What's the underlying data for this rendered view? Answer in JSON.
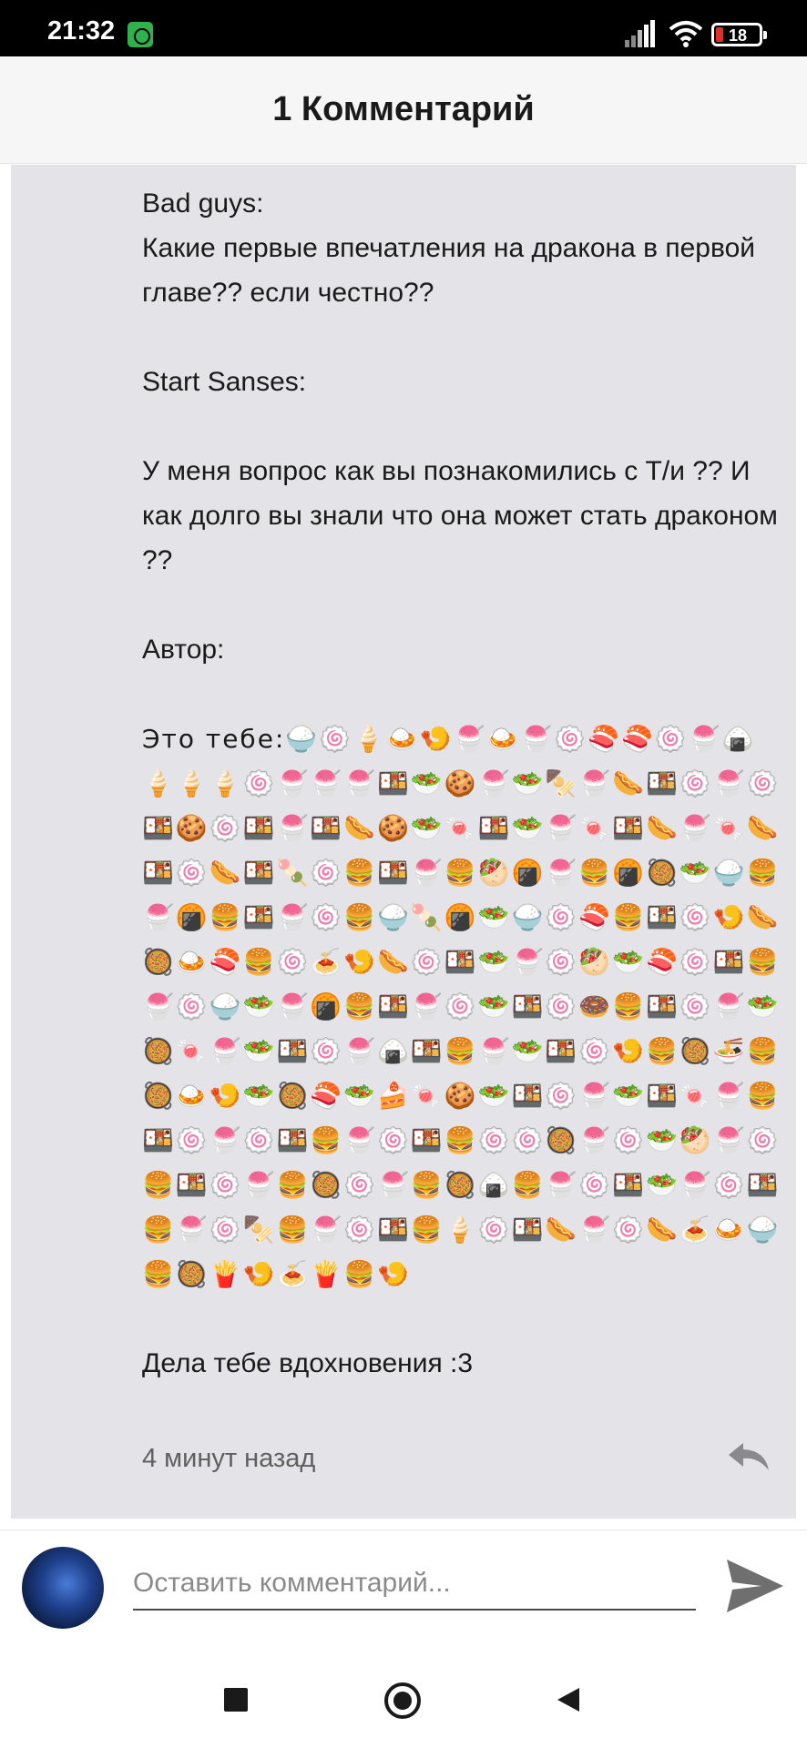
{
  "status_bar": {
    "time": "21:32",
    "battery_level": "18",
    "icons": [
      "app-notification-icon",
      "signal-icon",
      "wifi-icon",
      "battery-icon"
    ]
  },
  "header": {
    "title": "1 Комментарий"
  },
  "comment": {
    "lines": [
      "Bad guys:",
      "Какие первые впечатления на дракона в первой главе?? если честно??",
      "",
      "Start Sanses:",
      "",
      "У меня вопрос как вы познакомились с Т/и ?? И как долго вы знали что она может стать драконом ??",
      "",
      "Автор:",
      ""
    ],
    "emoji_label": "Это тебе:",
    "emoji_text": "🍚🍥🍦🍛🍤🍧🍛🍧🍥🍣🍣🍥🍧🍙🍦🍦🍦🍥🍧🍧🍧🍱🥗🍪🍧🥗🍢🍧🌭🍱🍥🍧🍥🍱🍪🍥🍱🍧🍱🌭🍪🥗🍬🍱🥗🍧🍬🍱🌭🍧🍬🌭🍱🍥🌭🍱🍡🍥🍔🍱🍧🍔🥙🍘🍧🍔🍘🥘🥗🍚🍔🍧🍘🍔🍱🍧🍥🍔🍚🍡🍘🥗🍚🍥🍣🍔🍱🍥🍤🌭🥘🍛🍣🍔🍥🍝🍤🌭🍥🍱🥗🍧🍥🥙🥗🍣🍥🍱🍔🍧🍥🍚🥗🍧🍘🍔🍱🍧🍥🥗🍱🍥🍩🍔🍱🍥🍧🥗🥘🍬🍧🥗🍱🍥🍧🍙🍱🍔🍧🥗🍱🍥🍤🍔🥘🍜🍔🥘🍛🍤🥗🥘🍣🥗🍰🍬🍪🥗🍱🍥🍧🥗🍱🍬🍧🍔🍱🍥🍧🍥🍱🍔🍧🍥🍱🍔🍥🍥🥘🍧🍥🥗🥙🍧🍥🍔🍱🍥🍧🍔🥘🍥🍧🍔🥘🍙🍔🍧🍥🍱🥗🍧🍥🍱🍔🍧🍥🍢🍔🍧🍥🍱🍔🍦🍥🍱🌭🍧🍥🌭🍝🍛🍚🍔🥘🍟🍤🍝🍟🍔🍤",
    "closing": "Дела тебе вдохновения :3",
    "time": "4 минут назад"
  },
  "composer": {
    "placeholder": "Оставить комментарий..."
  },
  "colors": {
    "card_background": "#e4e3e8",
    "header_background": "#f6f6f6",
    "status_bar": "#000000",
    "battery_low": "#e0302a"
  }
}
